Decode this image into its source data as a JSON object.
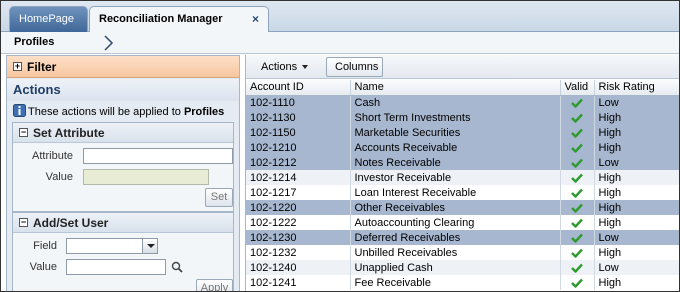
{
  "tabs": [
    {
      "label": "HomePage"
    },
    {
      "label": "Reconciliation Manager",
      "close": "×"
    }
  ],
  "breadcrumb": {
    "label": "Profiles"
  },
  "left": {
    "filter_label": "Filter",
    "actions_title": "Actions",
    "info_prefix": "These actions will be applied to ",
    "info_target": "Profiles",
    "set_attribute": {
      "title": "Set Attribute",
      "attribute_label": "Attribute",
      "value_label": "Value",
      "set_button": "Set"
    },
    "add_user": {
      "title": "Add/Set User",
      "field_label": "Field",
      "value_label": "Value",
      "apply_button": "Apply"
    }
  },
  "toolbar": {
    "actions_label": "Actions",
    "columns_label": "Columns"
  },
  "grid": {
    "headers": [
      "Account ID",
      "Name",
      "Valid",
      "Risk Rating"
    ],
    "rows": [
      {
        "id": "102-1110",
        "name": "Cash",
        "risk": "Low",
        "style": "sel"
      },
      {
        "id": "102-1130",
        "name": "Short Term Investments",
        "risk": "High",
        "style": "sel"
      },
      {
        "id": "102-1150",
        "name": "Marketable Securities",
        "risk": "High",
        "style": "sel"
      },
      {
        "id": "102-1210",
        "name": "Accounts Receivable",
        "risk": "High",
        "style": "sel"
      },
      {
        "id": "102-1212",
        "name": "Notes Receivable",
        "risk": "Low",
        "style": "sel"
      },
      {
        "id": "102-1214",
        "name": "Investor Receivable",
        "risk": "High",
        "style": "alt"
      },
      {
        "id": "102-1217",
        "name": "Loan Interest Receivable",
        "risk": "High",
        "style": "plain"
      },
      {
        "id": "102-1220",
        "name": "Other Receivables",
        "risk": "High",
        "style": "sel"
      },
      {
        "id": "102-1222",
        "name": "Autoaccounting Clearing",
        "risk": "High",
        "style": "plain"
      },
      {
        "id": "102-1230",
        "name": "Deferred Receivables",
        "risk": "Low",
        "style": "sel"
      },
      {
        "id": "102-1232",
        "name": "Unbilled Receivables",
        "risk": "High",
        "style": "plain"
      },
      {
        "id": "102-1240",
        "name": "Unapplied Cash",
        "risk": "Low",
        "style": "alt"
      },
      {
        "id": "102-1241",
        "name": "Fee Receivable",
        "risk": "High",
        "style": "plain"
      }
    ]
  },
  "colors": {
    "valid_check": "#2f9a2f",
    "selected_row": "#a7b7cf",
    "accent": "#3f6798"
  },
  "icons": {
    "valid": "checkmark-icon",
    "search": "search-icon",
    "info": "info-icon"
  }
}
